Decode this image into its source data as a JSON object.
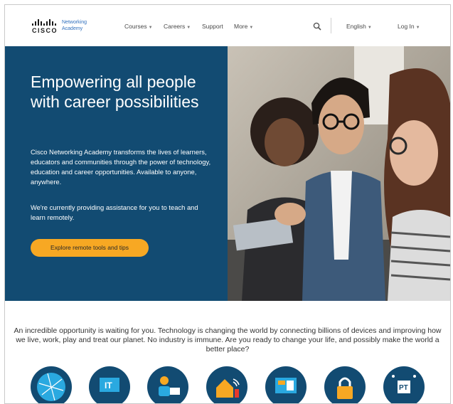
{
  "header": {
    "brand": "CISCO",
    "academy_line1": "Networking",
    "academy_line2": "Academy",
    "nav": [
      {
        "label": "Courses",
        "caret": true
      },
      {
        "label": "Careers",
        "caret": true
      },
      {
        "label": "Support",
        "caret": false
      },
      {
        "label": "More",
        "caret": true
      }
    ],
    "language": "English",
    "login": "Log In"
  },
  "hero": {
    "title": "Empowering all people with career possibilities",
    "paragraph": "Cisco Networking Academy transforms the lives of learners, educators and communities through the power of technology, education and career opportunities. Available to anyone, anywhere.",
    "paragraph2": "We're currently providing assistance for you to teach and learn remotely.",
    "cta": "Explore remote tools and tips"
  },
  "intro": "An incredible opportunity is waiting for you. Technology is changing the world by connecting billions of devices and improving how we live, work, play and treat our planet. No industry is immune. Are you ready to change your life, and possibly make the world a better place?",
  "feature_icons": [
    {
      "icon": "globe-network-icon"
    },
    {
      "icon": "it-icon",
      "text": "IT"
    },
    {
      "icon": "person-laptop-icon"
    },
    {
      "icon": "smart-home-icon"
    },
    {
      "icon": "dashboard-icon"
    },
    {
      "icon": "padlock-icon"
    },
    {
      "icon": "packet-tracer-icon",
      "text": "PT"
    }
  ],
  "colors": {
    "hero_bg": "#124b72",
    "cta": "#f7a823",
    "link": "#2f6fbd"
  }
}
